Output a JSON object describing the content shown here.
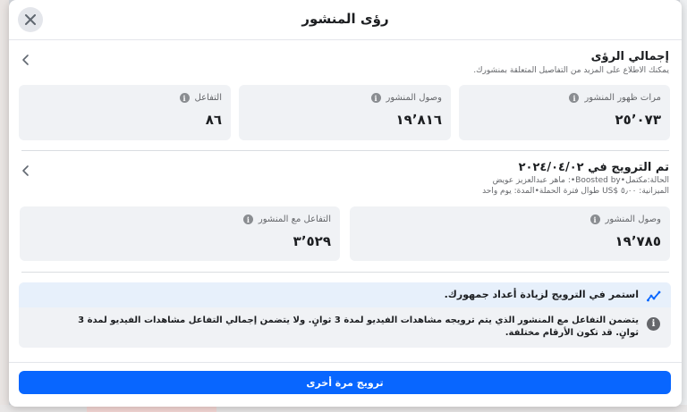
{
  "header": {
    "title": "رؤى المنشور",
    "close_icon": "close-icon"
  },
  "overview": {
    "title": "إجمالي الرؤى",
    "subtitle": "يمكنك الاطلاع على المزيد من التفاصيل المتعلقة بمنشورك.",
    "metrics": [
      {
        "label": "مرات ظهور المنشور",
        "value": "٢٥٬٠٧٣"
      },
      {
        "label": "وصول المنشور",
        "value": "١٩٬٨١٦"
      },
      {
        "label": "التفاعل",
        "value": "٨٦"
      }
    ]
  },
  "boost": {
    "title": "تم الترويج في ٢٠٢٤/٠٤/٠٢",
    "status_line": "الحالة:مكتمل•Boosted by•: ماهر عبدالعزيز عويض",
    "budget_line": "الميزانية: ٥٫٠٠ $US طوال فترة الحملة•المدة: يوم واحد",
    "metrics": [
      {
        "label": "وصول المنشور",
        "value": "١٩٬٧٨٥"
      },
      {
        "label": "التفاعل مع المنشور",
        "value": "٣٬٥٢٩"
      }
    ]
  },
  "promo": {
    "text": "استمر في الترويج لزيادة أعداد جمهورك.",
    "note": "يتضمن التفاعل مع المنشور الذي يتم ترويجه مشاهدات الفيديو لمدة 3 ثوانٍ. ولا يتضمن إجمالي التفاعل مشاهدات الفيديو لمدة 3 ثوانٍ. قد تكون الأرقام مختلفة."
  },
  "footer": {
    "boost_again_label": "ترويج مرة أخرى"
  },
  "colors": {
    "accent": "#0866ff",
    "card_bg": "#f0f2f5",
    "promo_bg": "#e7f0fb"
  }
}
